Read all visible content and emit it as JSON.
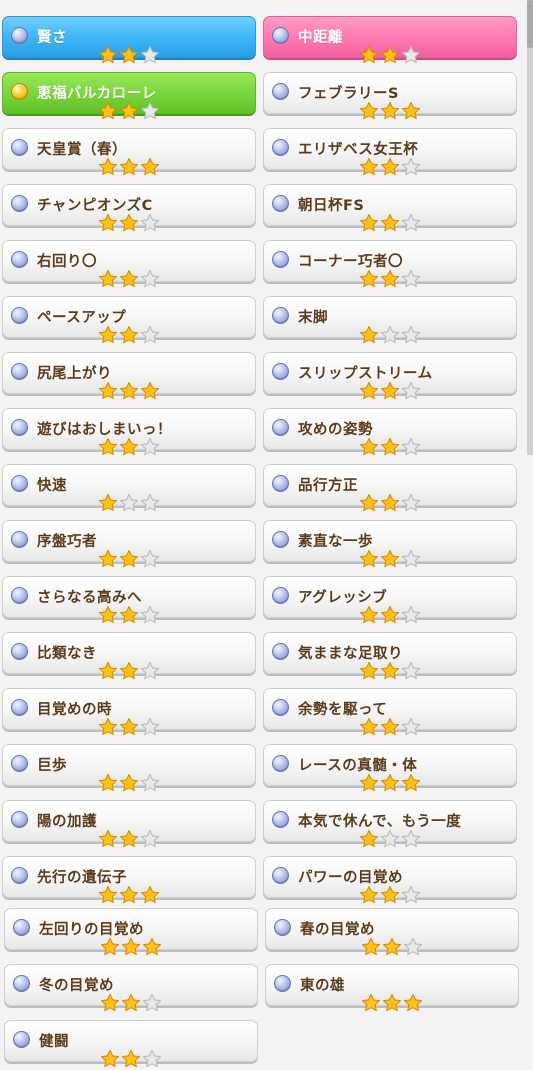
{
  "colors": {
    "label_text": "#5b3b1d",
    "star_on": "#ffc21a",
    "star_off": "#e9e9e9",
    "blue_card": "#3cb4f5",
    "pink_card": "#ff78b0",
    "green_card": "#78d53a"
  },
  "skills": [
    {
      "label": "賢さ",
      "stars": 2,
      "style": "blue",
      "icon": "blue-circle-icon"
    },
    {
      "label": "中距離",
      "stars": 2,
      "style": "pink",
      "icon": "blue-circle-icon"
    },
    {
      "label": "恵福バルカローレ",
      "stars": 2,
      "style": "green",
      "icon": "gold-circle-icon"
    },
    {
      "label": "フェブラリーS",
      "stars": 3,
      "style": "normal",
      "icon": "blue-circle-icon"
    },
    {
      "label": "天皇賞（春）",
      "stars": 3,
      "style": "normal",
      "icon": "blue-circle-icon"
    },
    {
      "label": "エリザベス女王杯",
      "stars": 2,
      "style": "normal",
      "icon": "blue-circle-icon"
    },
    {
      "label": "チャンピオンズC",
      "stars": 2,
      "style": "normal",
      "icon": "blue-circle-icon"
    },
    {
      "label": "朝日杯FS",
      "stars": 2,
      "style": "normal",
      "icon": "blue-circle-icon"
    },
    {
      "label": "右回り〇",
      "stars": 2,
      "style": "normal",
      "icon": "blue-circle-icon"
    },
    {
      "label": "コーナー巧者〇",
      "stars": 2,
      "style": "normal",
      "icon": "blue-circle-icon"
    },
    {
      "label": "ペースアップ",
      "stars": 2,
      "style": "normal",
      "icon": "blue-circle-icon"
    },
    {
      "label": "末脚",
      "stars": 1,
      "style": "normal",
      "icon": "blue-circle-icon"
    },
    {
      "label": "尻尾上がり",
      "stars": 3,
      "style": "normal",
      "icon": "blue-circle-icon"
    },
    {
      "label": "スリップストリーム",
      "stars": 2,
      "style": "normal",
      "icon": "blue-circle-icon"
    },
    {
      "label": "遊びはおしまいっ！",
      "stars": 2,
      "style": "normal",
      "icon": "blue-circle-icon"
    },
    {
      "label": "攻めの姿勢",
      "stars": 2,
      "style": "normal",
      "icon": "blue-circle-icon"
    },
    {
      "label": "快速",
      "stars": 1,
      "style": "normal",
      "icon": "blue-circle-icon"
    },
    {
      "label": "品行方正",
      "stars": 2,
      "style": "normal",
      "icon": "blue-circle-icon"
    },
    {
      "label": "序盤巧者",
      "stars": 2,
      "style": "normal",
      "icon": "blue-circle-icon"
    },
    {
      "label": "素直な一歩",
      "stars": 2,
      "style": "normal",
      "icon": "blue-circle-icon"
    },
    {
      "label": "さらなる高みへ",
      "stars": 2,
      "style": "normal",
      "icon": "blue-circle-icon"
    },
    {
      "label": "アグレッシブ",
      "stars": 2,
      "style": "normal",
      "icon": "blue-circle-icon"
    },
    {
      "label": "比類なき",
      "stars": 2,
      "style": "normal",
      "icon": "blue-circle-icon"
    },
    {
      "label": "気ままな足取り",
      "stars": 2,
      "style": "normal",
      "icon": "blue-circle-icon"
    },
    {
      "label": "目覚めの時",
      "stars": 2,
      "style": "normal",
      "icon": "blue-circle-icon"
    },
    {
      "label": "余勢を駆って",
      "stars": 2,
      "style": "normal",
      "icon": "blue-circle-icon"
    },
    {
      "label": "巨歩",
      "stars": 2,
      "style": "normal",
      "icon": "blue-circle-icon"
    },
    {
      "label": "レースの真髄・体",
      "stars": 3,
      "style": "normal",
      "icon": "blue-circle-icon"
    },
    {
      "label": "陽の加護",
      "stars": 2,
      "style": "normal",
      "icon": "blue-circle-icon"
    },
    {
      "label": "本気で休んで、もう一度",
      "stars": 1,
      "style": "normal",
      "icon": "blue-circle-icon"
    },
    {
      "label": "先行の遺伝子",
      "stars": 3,
      "style": "normal",
      "icon": "blue-circle-icon"
    },
    {
      "label": "パワーの目覚め",
      "stars": 2,
      "style": "normal",
      "icon": "blue-circle-icon"
    },
    {
      "label": "左回りの目覚め",
      "stars": 3,
      "style": "normal",
      "icon": "blue-circle-icon"
    },
    {
      "label": "春の目覚め",
      "stars": 2,
      "style": "normal",
      "icon": "blue-circle-icon"
    },
    {
      "label": "冬の目覚め",
      "stars": 2,
      "style": "normal",
      "icon": "blue-circle-icon"
    },
    {
      "label": "東の雄",
      "stars": 3,
      "style": "normal",
      "icon": "blue-circle-icon"
    },
    {
      "label": "健闘",
      "stars": 2,
      "style": "normal",
      "icon": "blue-circle-icon"
    }
  ]
}
